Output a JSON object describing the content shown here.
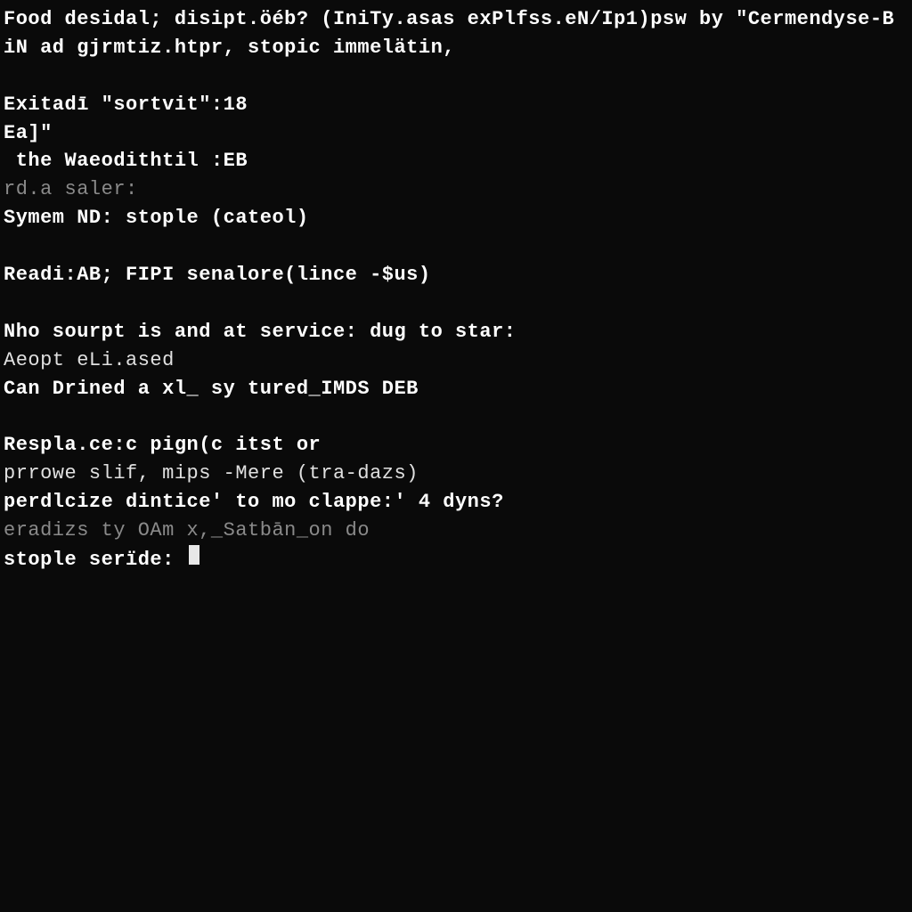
{
  "lines": [
    {
      "text": "Food desidal; disipt.öéb? (IniTy.asas exPlfss.eN/Ip1)psw by \"Cermendyse-B",
      "style": "bright"
    },
    {
      "text": "iN ad gjrmtiz.htpr, stopic immelätin,",
      "style": "bright"
    },
    {
      "text": "",
      "style": "blank"
    },
    {
      "text": "Exitadī \"sortvit\":18",
      "style": "bright"
    },
    {
      "text": "Ea]\"",
      "style": "bright"
    },
    {
      "text": " the Waeodithtil :EB",
      "style": "bright"
    },
    {
      "text": "rd.a saler:",
      "style": "dim"
    },
    {
      "text": "Symem ND: stople (cateol)",
      "style": "bright"
    },
    {
      "text": "",
      "style": "blank"
    },
    {
      "text": "Readi:AB; FIPI senalore(lince -$us)",
      "style": "bright"
    },
    {
      "text": "",
      "style": "blank"
    },
    {
      "text": "Nho sourpt is and at service: dug to star:",
      "style": "bright"
    },
    {
      "text": "Aeopt eLi.ased",
      "style": "normal"
    },
    {
      "text": "Can Drined a xl_ sy tured_IMDS DEB",
      "style": "bright"
    },
    {
      "text": "",
      "style": "blank"
    },
    {
      "text": "Respla.ce:c pign(c itst or",
      "style": "bright"
    },
    {
      "text": "prrowe slif, mips -Mere (tra-dazs)",
      "style": "normal"
    },
    {
      "text": "perdlcize dintice' to mo clappe:' 4 dyns?",
      "style": "bright"
    },
    {
      "text": "eradizs ty OAm x,_Satbān_on do",
      "style": "dim"
    }
  ],
  "prompt": "stople serïde: "
}
